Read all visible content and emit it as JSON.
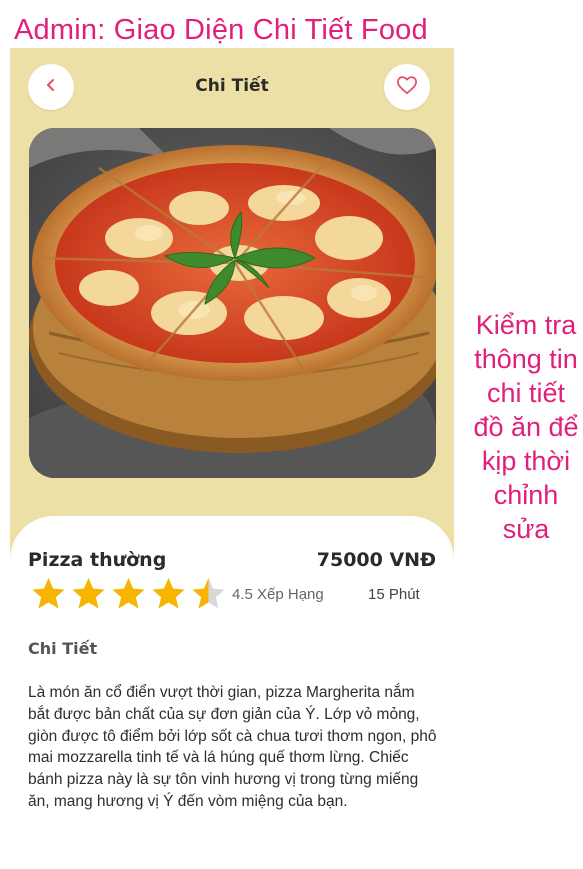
{
  "slide_title": "Admin: Giao Diện Chi Tiết Food",
  "side_note": "Kiểm tra thông tin chi tiết đồ ăn để kịp thời chỉnh sửa",
  "colors": {
    "annotation": "#e0207a",
    "header_bg": "#ece0a7",
    "star": "#f7b500",
    "heart": "#e34d6a"
  },
  "header": {
    "title": "Chi Tiết",
    "back_icon": "chevron-left-icon",
    "favorite_icon": "heart-outline-icon"
  },
  "food": {
    "image_icon": "pizza-margherita-photo",
    "name": "Pizza thường",
    "price": "75000 VNĐ",
    "rating_value": 4.5,
    "rating_max": 5,
    "rating_label": "4.5 Xếp Hạng",
    "time_label": "15 Phút",
    "details_title": "Chi Tiết",
    "description": "Là món ăn cổ điển vượt thời gian, pizza Margherita nắm bắt được bản chất của sự đơn giản của Ý. Lớp vỏ mỏng, giòn được tô điểm bởi lớp sốt cà chua tươi thơm ngon, phô mai mozzarella tinh tế và lá húng quế thơm lừng. Chiếc bánh pizza này là sự tôn vinh hương vị trong từng miếng ăn, mang hương vị Ý đến vòm miệng của bạn."
  }
}
